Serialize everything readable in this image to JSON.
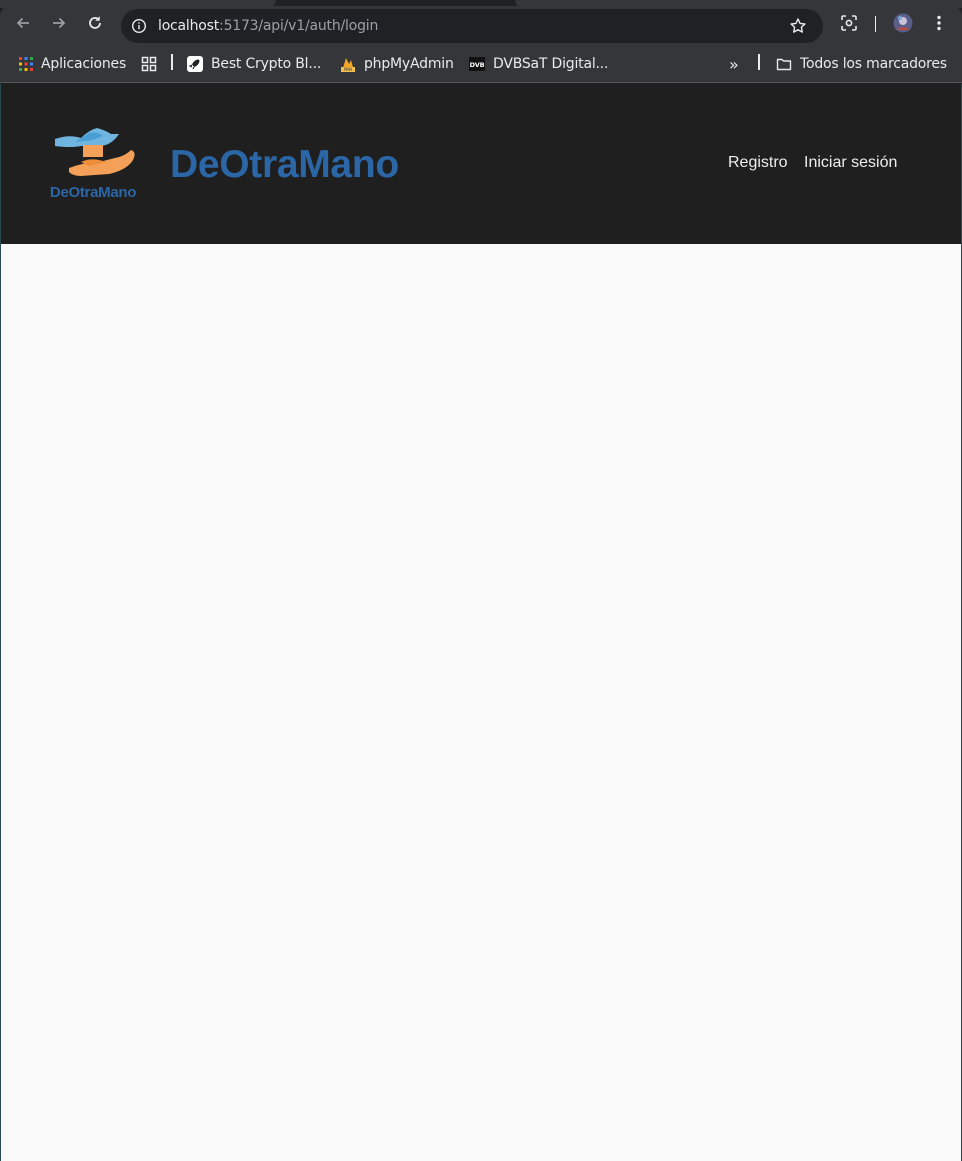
{
  "browser": {
    "address_host": "localhost",
    "address_path": ":5173/api/v1/auth/login",
    "icons": {
      "back": "back-arrow-icon",
      "forward": "forward-arrow-icon",
      "reload": "reload-icon",
      "site_info": "info-icon",
      "bookmark_star": "star-icon",
      "screenshot": "screenshot-icon",
      "profile": "avatar",
      "menu": "more-vertical-icon"
    },
    "bookmarks": [
      {
        "label": "Aplicaciones",
        "icon": "apps-grid-icon"
      },
      {
        "label": "",
        "icon": "tab-groups-icon"
      },
      {
        "label": "Best Crypto Bl...",
        "icon": "rocket-icon"
      },
      {
        "label": "phpMyAdmin",
        "icon": "phpmyadmin-icon"
      },
      {
        "label": "DVBSaT Digital...",
        "icon": "dvb-icon"
      }
    ],
    "overflow_label": "»",
    "all_bookmarks_label": "Todos los marcadores"
  },
  "site": {
    "logo_text": "DeOtraMano",
    "brand": "DeOtraMano",
    "nav": [
      {
        "label": "Registro"
      },
      {
        "label": "Iniciar sesión"
      }
    ],
    "colors": {
      "header_bg": "#1f1f20",
      "brand": "#2b66a6",
      "page_bg": "#f9f9f9"
    }
  }
}
